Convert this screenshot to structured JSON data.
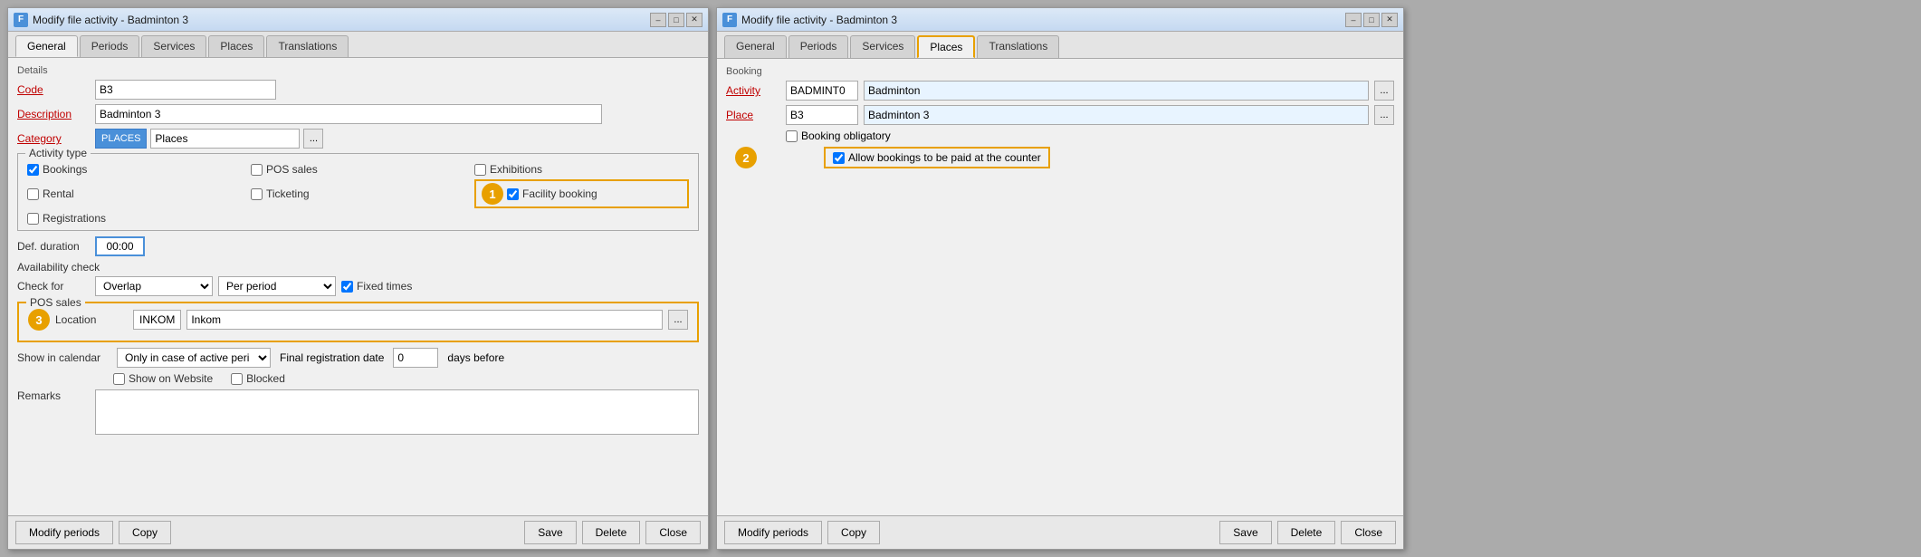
{
  "left_window": {
    "title": "Modify file activity - Badminton 3",
    "tabs": [
      {
        "id": "general",
        "label": "General",
        "active": true
      },
      {
        "id": "periods",
        "label": "Periods"
      },
      {
        "id": "services",
        "label": "Services"
      },
      {
        "id": "places",
        "label": "Places"
      },
      {
        "id": "translations",
        "label": "Translations"
      }
    ],
    "details_section": "Details",
    "fields": {
      "code_label": "Code",
      "code_value": "B3",
      "description_label": "Description",
      "description_value": "Badminton 3",
      "category_label": "Category",
      "category_tag": "PLACES",
      "category_value": "Places"
    },
    "activity_type": {
      "legend": "Activity type",
      "checkboxes": [
        {
          "id": "bookings",
          "label": "Bookings",
          "checked": true
        },
        {
          "id": "pos_sales",
          "label": "POS sales",
          "checked": false
        },
        {
          "id": "exhibitions",
          "label": "Exhibitions",
          "checked": false
        },
        {
          "id": "rental",
          "label": "Rental",
          "checked": false
        },
        {
          "id": "ticketing",
          "label": "Ticketing",
          "checked": false
        },
        {
          "id": "facility_booking",
          "label": "Facility booking",
          "checked": true
        },
        {
          "id": "registrations",
          "label": "Registrations",
          "checked": false
        }
      ],
      "badge_number": "1"
    },
    "def_duration": {
      "label": "Def. duration",
      "value": "00:00"
    },
    "availability": {
      "section_label": "Availability check",
      "check_for_label": "Check for",
      "overlap_value": "Overlap",
      "per_period_value": "Per period",
      "fixed_times_label": "Fixed times",
      "fixed_times_checked": true
    },
    "pos_sales": {
      "legend": "POS sales",
      "location_label": "Location",
      "location_code": "INKOM",
      "location_name": "Inkom",
      "badge_number": "3"
    },
    "show_calendar": {
      "label": "Show in calendar",
      "dropdown_value": "Only in case of active peri",
      "show_website_label": "Show on Website",
      "show_website_checked": false,
      "final_reg_label": "Final registration date",
      "final_reg_value": "0",
      "days_before_label": "days before",
      "blocked_label": "Blocked",
      "blocked_checked": false
    },
    "remarks_label": "Remarks",
    "bottom_buttons": {
      "modify_periods": "Modify periods",
      "copy": "Copy",
      "save": "Save",
      "delete": "Delete",
      "close": "Close"
    }
  },
  "right_window": {
    "title": "Modify file activity - Badminton 3",
    "tabs": [
      {
        "id": "general",
        "label": "General"
      },
      {
        "id": "periods",
        "label": "Periods"
      },
      {
        "id": "services",
        "label": "Services"
      },
      {
        "id": "places",
        "label": "Places",
        "active": true
      },
      {
        "id": "translations",
        "label": "Translations"
      }
    ],
    "booking_section": "Booking",
    "activity_label": "Activity",
    "activity_code": "BADMINT0",
    "activity_name": "Badminton",
    "place_label": "Place",
    "place_code": "B3",
    "place_name": "Badminton 3",
    "booking_obligatory_label": "Booking obligatory",
    "booking_obligatory_checked": false,
    "allow_bookings_label": "Allow bookings to be paid at the counter",
    "allow_bookings_checked": true,
    "badge_number": "2",
    "bottom_buttons": {
      "modify_periods": "Modify periods",
      "copy": "Copy",
      "save": "Save",
      "delete": "Delete",
      "close": "Close"
    }
  }
}
